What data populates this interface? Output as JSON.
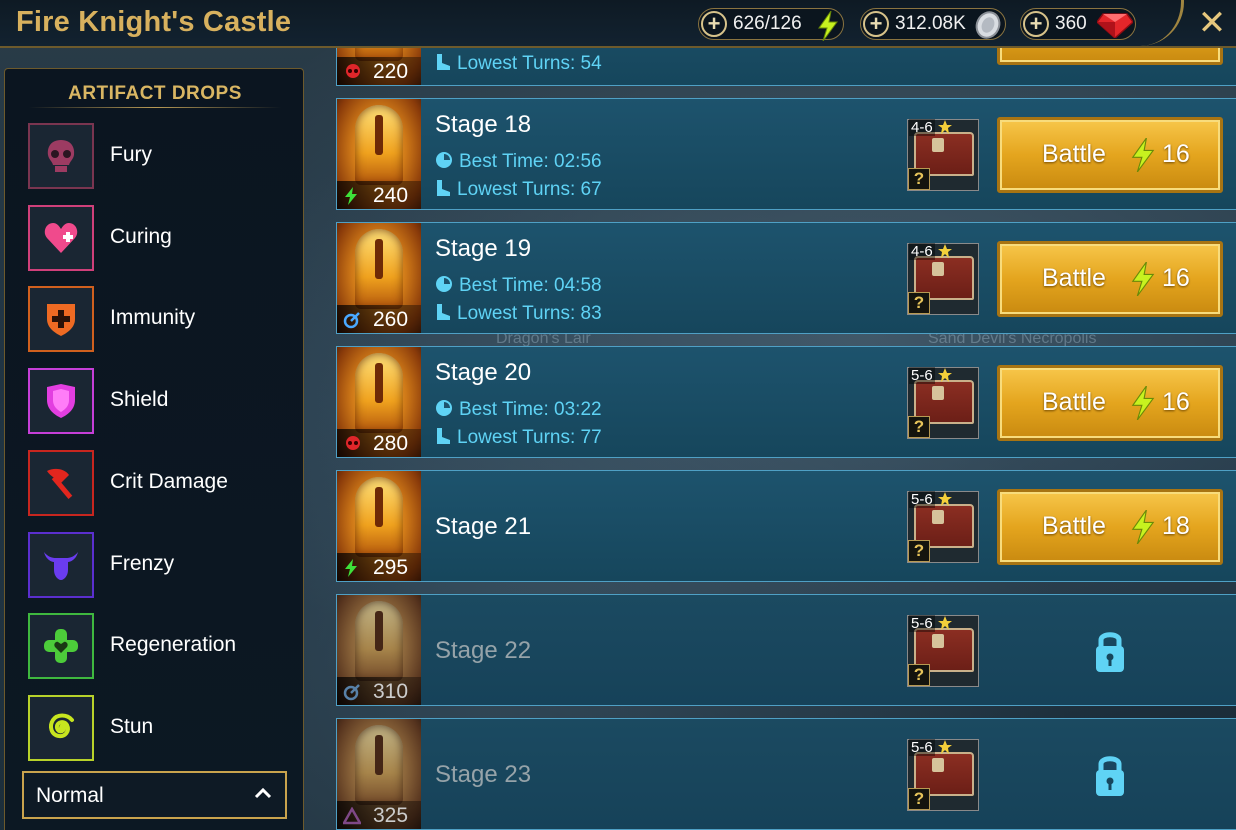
{
  "header": {
    "title": "Fire Knight's Castle",
    "resources": {
      "energy": "626/126",
      "silver": "312.08K",
      "gems": "360"
    }
  },
  "panel": {
    "title": "ARTIFACT DROPS",
    "drops": [
      {
        "label": "Fury",
        "color": "#7a3550",
        "icon": "skull-icon"
      },
      {
        "label": "Curing",
        "color": "#d0407a",
        "icon": "heart-plus-icon"
      },
      {
        "label": "Immunity",
        "color": "#d0601e",
        "icon": "shield-cross-icon"
      },
      {
        "label": "Shield",
        "color": "#c63fd8",
        "icon": "shield-icon"
      },
      {
        "label": "Crit Damage",
        "color": "#c8261f",
        "icon": "axe-icon"
      },
      {
        "label": "Frenzy",
        "color": "#5b2fcf",
        "icon": "bull-icon"
      },
      {
        "label": "Regeneration",
        "color": "#3fb83f",
        "icon": "clover-icon"
      },
      {
        "label": "Stun",
        "color": "#b8d22a",
        "icon": "spiral-icon"
      }
    ],
    "difficulty": "Normal"
  },
  "partial_stage": {
    "level": "220",
    "lowest_turns": "Lowest Turns: 54"
  },
  "stages": [
    {
      "name": "Stage 18",
      "level": "240",
      "affinity": "force",
      "best_time": "Best Time: 02:56",
      "lowest_turns": "Lowest Turns: 67",
      "rarity": "4-6",
      "battle": "Battle",
      "cost": "16",
      "locked": false
    },
    {
      "name": "Stage 19",
      "level": "260",
      "affinity": "magic",
      "best_time": "Best Time: 04:58",
      "lowest_turns": "Lowest Turns: 83",
      "rarity": "4-6",
      "battle": "Battle",
      "cost": "16",
      "locked": false
    },
    {
      "name": "Stage 20",
      "level": "280",
      "affinity": "void",
      "best_time": "Best Time: 03:22",
      "lowest_turns": "Lowest Turns: 77",
      "rarity": "5-6",
      "battle": "Battle",
      "cost": "16",
      "locked": false
    },
    {
      "name": "Stage 21",
      "level": "295",
      "affinity": "force",
      "best_time": "",
      "lowest_turns": "",
      "rarity": "5-6",
      "battle": "Battle",
      "cost": "18",
      "locked": false
    },
    {
      "name": "Stage 22",
      "level": "310",
      "affinity": "magic",
      "best_time": "",
      "lowest_turns": "",
      "rarity": "5-6",
      "battle": "",
      "cost": "",
      "locked": true
    },
    {
      "name": "Stage 23",
      "level": "325",
      "affinity": "spirit",
      "best_time": "",
      "lowest_turns": "",
      "rarity": "5-6",
      "battle": "",
      "cost": "",
      "locked": true
    }
  ],
  "background_labels": {
    "left": "Dragon's Lair",
    "right": "Sand Devil's Necropolis"
  },
  "colors": {
    "gold": "#d8b15e",
    "stat_cyan": "#5fd3f5",
    "button_gold": "#e4a51e",
    "stage_bg": "#1d536d"
  }
}
